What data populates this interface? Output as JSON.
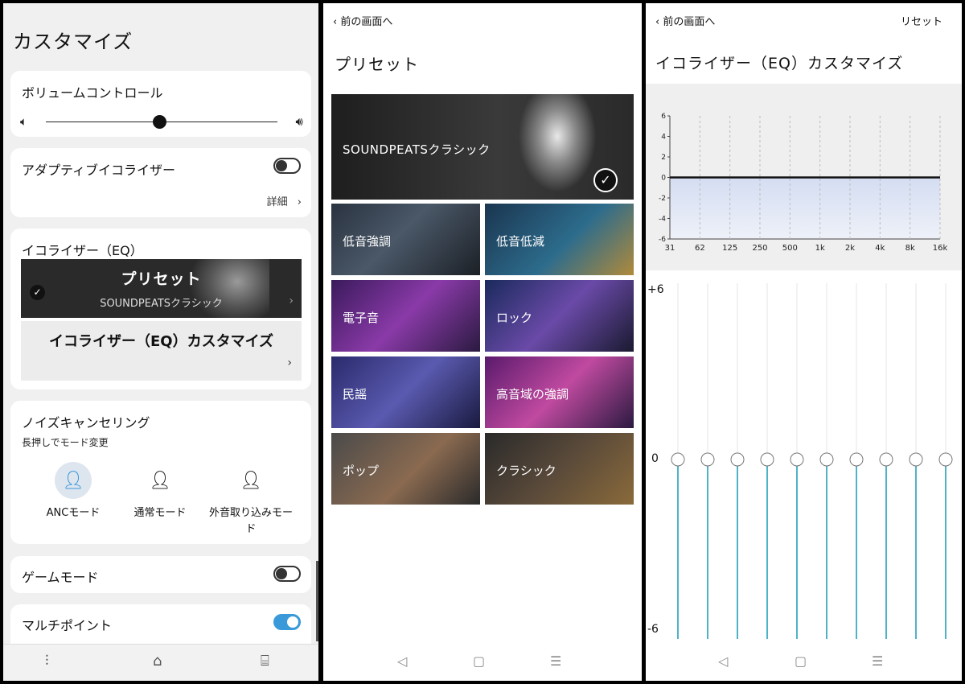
{
  "settings": {
    "title": "カスタマイズ",
    "volume": {
      "label": "ボリュームコントロール",
      "mute_icon": "speaker-mute-icon",
      "loud_icon": "speaker-loud-icon",
      "level": 0.49
    },
    "adaptive_eq": {
      "label": "アダプティブイコライザー",
      "enabled": false,
      "detail_label": "詳細"
    },
    "eq": {
      "label": "イコライザー（EQ）",
      "preset_title": "プリセット",
      "preset_current": "SOUNDPEATSクラシック",
      "custom_label": "イコライザー（EQ）カスタマイズ"
    },
    "noise_cancel": {
      "label": "ノイズキャンセリング",
      "hint": "長押しでモード変更",
      "modes": [
        {
          "label": "ANCモード",
          "active": true,
          "icon": "anc-icon"
        },
        {
          "label": "通常モード",
          "active": false,
          "icon": "normal-mode-icon"
        },
        {
          "label": "外音取り込みモード",
          "active": false,
          "icon": "ambient-icon"
        }
      ]
    },
    "game_mode": {
      "label": "ゲームモード",
      "enabled": false
    },
    "multipoint": {
      "label": "マルチポイント",
      "enabled": true
    },
    "bottom_nav": [
      "equalizer-icon",
      "home-icon",
      "store-icon"
    ]
  },
  "presets": {
    "back_label": "前の画面へ",
    "title": "プリセット",
    "items": [
      {
        "label": "SOUNDPEATSクラシック",
        "selected": true
      },
      {
        "label": "低音強調"
      },
      {
        "label": "低音低減"
      },
      {
        "label": "電子音"
      },
      {
        "label": "ロック"
      },
      {
        "label": "民謡"
      },
      {
        "label": "高音域の強調"
      },
      {
        "label": "ポップ"
      },
      {
        "label": "クラシック"
      }
    ]
  },
  "eq_custom": {
    "back_label": "前の画面へ",
    "reset_label": "リセット",
    "title": "イコライザー（EQ）カスタマイズ",
    "slider_max_label": "+6",
    "slider_zero_label": "0",
    "slider_min_label": "-6",
    "chart_data": {
      "type": "line",
      "x": [
        "31",
        "62",
        "125",
        "250",
        "500",
        "1k",
        "2k",
        "4k",
        "8k",
        "16k"
      ],
      "values": [
        0,
        0,
        0,
        0,
        0,
        0,
        0,
        0,
        0,
        0
      ],
      "ylim": [
        -6,
        6
      ],
      "yticks": [
        "6",
        "4",
        "2",
        "0",
        "-2",
        "-4",
        "-6"
      ],
      "grid": true
    }
  },
  "system_nav": [
    "back-icon",
    "home-square-icon",
    "menu-icon"
  ]
}
